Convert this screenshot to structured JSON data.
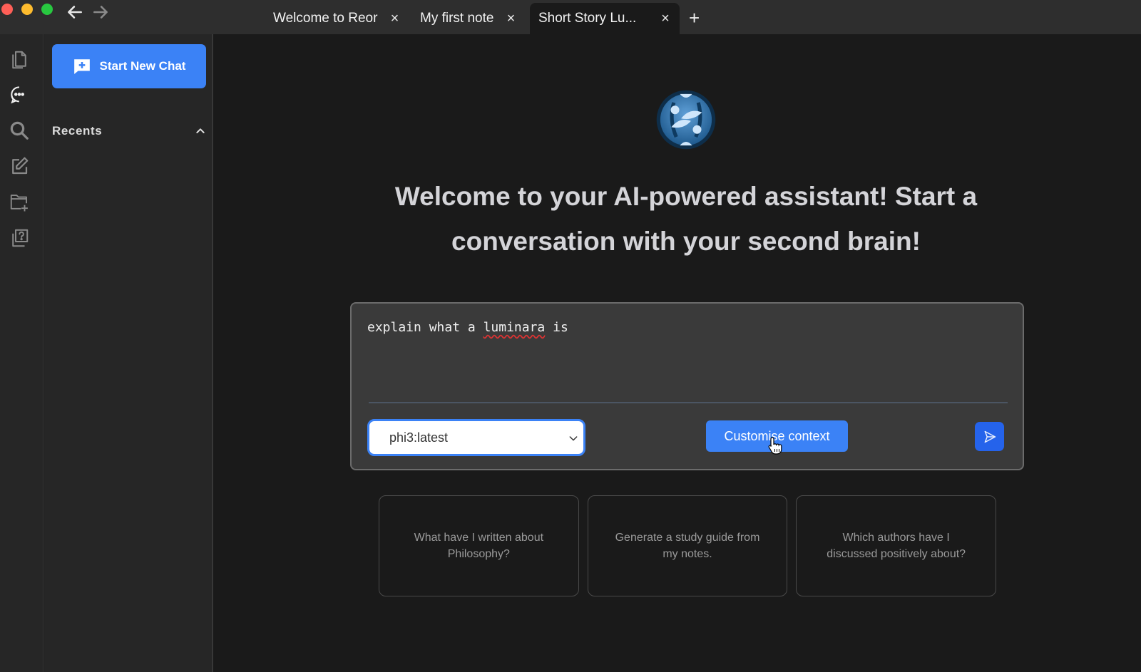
{
  "window": {
    "nav": {
      "back_icon": "arrow-left-icon",
      "forward_icon": "arrow-right-icon"
    },
    "tabs": [
      {
        "label": "Welcome to Reor",
        "close": "×",
        "active": false
      },
      {
        "label": "My first note",
        "close": "×",
        "active": false
      },
      {
        "label": "Short Story Lu...",
        "close": "×",
        "active": true
      }
    ],
    "add_tab": "+"
  },
  "iconbar": {
    "items": [
      {
        "icon": "files-icon"
      },
      {
        "icon": "chat-icon",
        "active": true
      },
      {
        "icon": "search-icon"
      },
      {
        "icon": "edit-note-icon"
      },
      {
        "icon": "new-folder-icon"
      },
      {
        "icon": "help-icon"
      }
    ]
  },
  "sidebar": {
    "new_chat_label": "Start New Chat",
    "recents_label": "Recents"
  },
  "main": {
    "headline": "Welcome to your AI-powered assistant! Start a conversation with your second brain!",
    "composer": {
      "prompt_before": "explain what a ",
      "prompt_misspelled": "luminara",
      "prompt_after": " is",
      "model": "phi3:latest",
      "customise_label": "Customise context"
    },
    "suggestions": [
      "What have I written about Philosophy?",
      "Generate a study guide from my notes.",
      "Which authors have I discussed positively about?"
    ]
  },
  "colors": {
    "accent": "#3b82f6",
    "send": "#2563eb",
    "background": "#1a1a1a",
    "sidebar": "#262626",
    "composer": "#3a3a3a"
  }
}
